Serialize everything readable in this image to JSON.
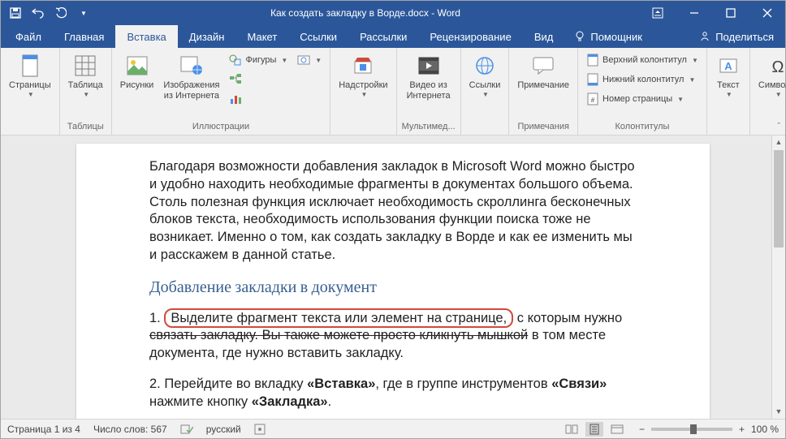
{
  "title": "Как создать закладку в Ворде.docx  -  Word",
  "tabs": {
    "file": "Файл",
    "home": "Главная",
    "insert": "Вставка",
    "design": "Дизайн",
    "layout": "Макет",
    "references": "Ссылки",
    "mailings": "Рассылки",
    "review": "Рецензирование",
    "view": "Вид",
    "tellme": "Помощник",
    "share": "Поделиться"
  },
  "ribbon": {
    "pages": {
      "label": "Страницы",
      "group": ""
    },
    "tables": {
      "label": "Таблица",
      "group": "Таблицы"
    },
    "illustrations": {
      "pictures": "Рисунки",
      "online": "Изображения из Интернета",
      "shapes": "Фигуры",
      "smartart": "",
      "chart": "",
      "screenshot": "",
      "group": "Иллюстрации"
    },
    "addins": {
      "label": "Надстройки",
      "group": ""
    },
    "media": {
      "label": "Видео из Интернета",
      "group": "Мультимед..."
    },
    "links": {
      "label": "Ссылки",
      "group": ""
    },
    "comments": {
      "label": "Примечание",
      "group": "Примечания"
    },
    "header_footer": {
      "header": "Верхний колонтитул",
      "footer": "Нижний колонтитул",
      "page_num": "Номер страницы",
      "group": "Колонтитулы"
    },
    "text": {
      "label": "Текст",
      "group": ""
    },
    "symbols": {
      "label": "Символы",
      "group": ""
    }
  },
  "doc": {
    "p1": "Благодаря возможности добавления закладок в Microsoft Word можно быстро и удобно находить необходимые фрагменты в документах большого объема. Столь полезная функция исключает необходимость скроллинга бесконечных блоков текста, необходимость использования функции поиска тоже не возникает. Именно о том, как создать закладку в Ворде и как ее изменить мы и расскажем в данной статье.",
    "h2": "Добавление закладки в документ",
    "step1_a": "1. ",
    "step1_hl": "Выделите фрагмент текста или элемент на странице,",
    "step1_b": " с которым нужно ",
    "step1_strike": "связать закладку. Вы также можете просто кликнуть мышкой",
    "step1_c": " в том месте документа, где нужно вставить закладку.",
    "step2_a": "2. Перейдите во вкладку ",
    "step2_b1": "«Вставка»",
    "step2_c": ", где в группе инструментов ",
    "step2_b2": "«Связи»",
    "step2_d": " нажмите кнопку ",
    "step2_b3": "«Закладка»",
    "step2_e": "."
  },
  "status": {
    "page": "Страница 1 из 4",
    "words": "Число слов: 567",
    "lang": "русский",
    "zoom": "100 %"
  }
}
